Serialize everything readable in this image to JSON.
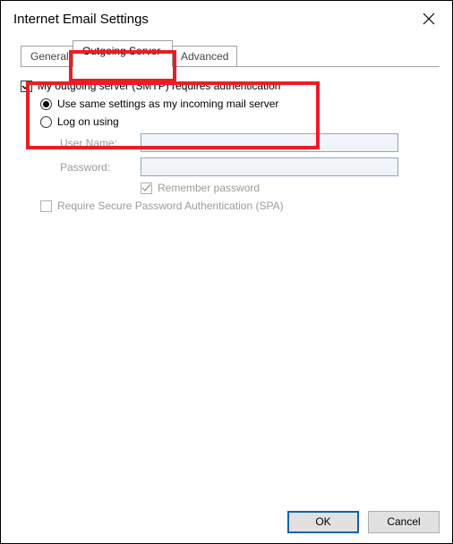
{
  "title": "Internet Email Settings",
  "tabs": {
    "general": "General",
    "outgoing": "Outgoing Server",
    "advanced": "Advanced",
    "active": "outgoing"
  },
  "options": {
    "requires_auth": {
      "label": "My outgoing server (SMTP) requires authentication",
      "checked": true
    },
    "use_same": {
      "label": "Use same settings as my incoming mail server",
      "selected": true
    },
    "log_on_using": {
      "label": "Log on using",
      "selected": false
    }
  },
  "fields": {
    "username": {
      "label": "User Name:",
      "value": ""
    },
    "password": {
      "label": "Password:",
      "value": ""
    },
    "remember": {
      "label": "Remember password",
      "checked": true
    },
    "spa": {
      "label": "Require Secure Password Authentication (SPA)",
      "checked": false
    }
  },
  "buttons": {
    "ok": "OK",
    "cancel": "Cancel"
  }
}
